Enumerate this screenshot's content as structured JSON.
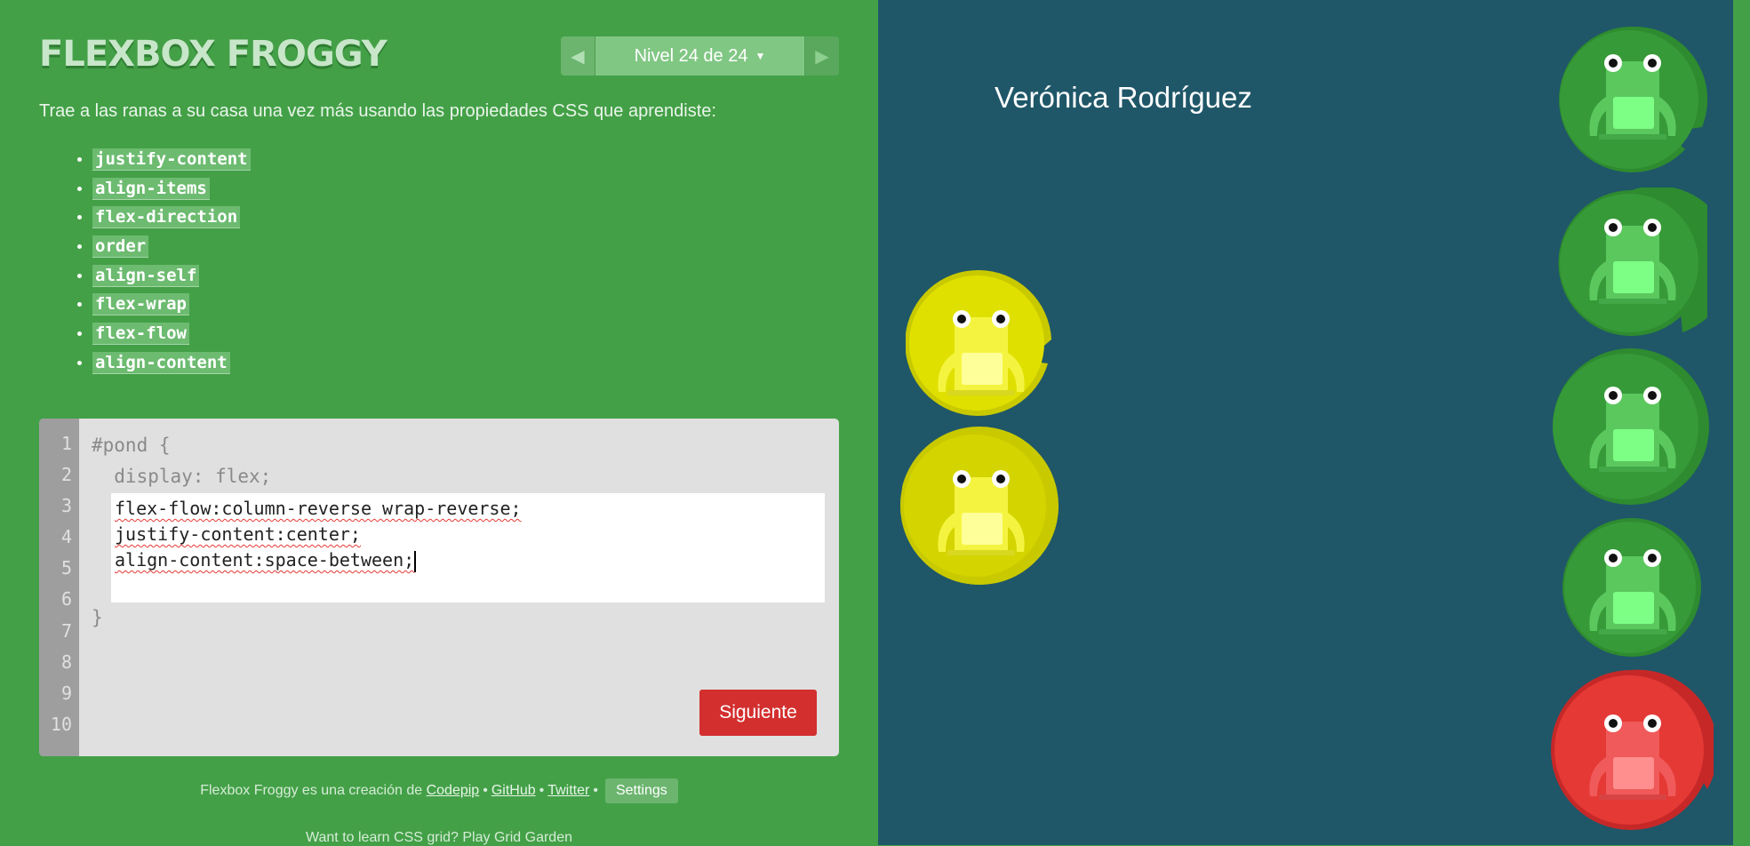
{
  "header": {
    "logo": "FLEXBOX FROGGY",
    "level_label": "Nivel 24 de 24"
  },
  "instructions": "Trae a las ranas a su casa una vez más usando las propiedades CSS que aprendiste:",
  "properties": [
    "justify-content",
    "align-items",
    "flex-direction",
    "order",
    "align-self",
    "flex-wrap",
    "flex-flow",
    "align-content"
  ],
  "editor": {
    "line_numbers": [
      "1",
      "2",
      "3",
      "4",
      "5",
      "6",
      "7",
      "8",
      "9",
      "10"
    ],
    "prefix": [
      "#pond {",
      "  display: flex;"
    ],
    "input_lines": [
      "flex-flow:column-reverse wrap-reverse;",
      "justify-content:center;",
      "align-content:space-between;"
    ],
    "suffix": "}",
    "next_label": "Siguiente"
  },
  "footer": {
    "credit_text": "Flexbox Froggy es una creación de",
    "links": [
      "Codepip",
      "GitHub",
      "Twitter"
    ],
    "settings_label": "Settings",
    "grid_text": "Want to learn CSS grid? Play Grid Garden"
  },
  "pond": {
    "username": "Verónica Rodríguez"
  },
  "colors": {
    "green": "#43a047",
    "pond": "#1f5768",
    "yellow": "#d4d400",
    "red": "#e53935"
  }
}
